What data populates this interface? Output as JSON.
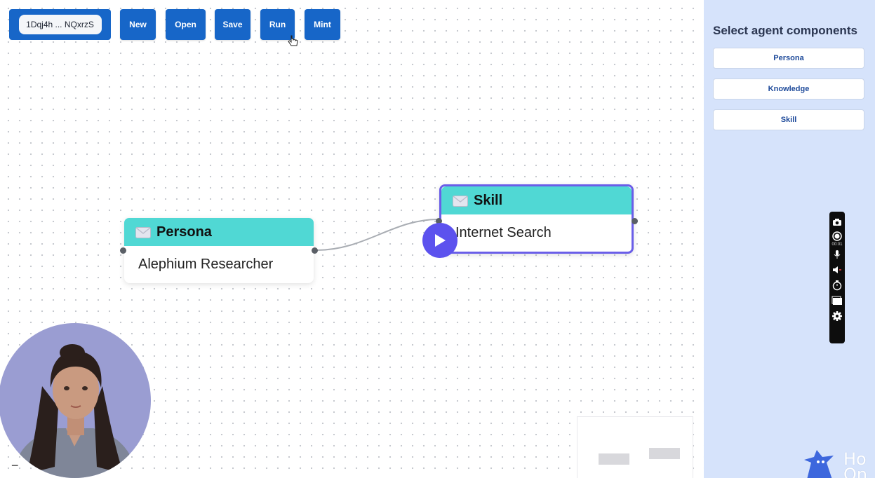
{
  "toolbar": {
    "wallet_address": "1Dqj4h ... NQxrzS",
    "buttons": [
      "New",
      "Open",
      "Save",
      "Run",
      "Mint"
    ]
  },
  "nodes": {
    "persona": {
      "header": "Persona",
      "value": "Alephium Researcher"
    },
    "skill": {
      "header": "Skill",
      "value": "Internet Search"
    }
  },
  "panel": {
    "title": "Select agent components",
    "components": [
      "Persona",
      "Knowledge",
      "Skill"
    ]
  },
  "recorder": {
    "time": "00:01"
  },
  "brand": {
    "line1": "Ho",
    "line2": "On"
  },
  "colors": {
    "toolbar_blue": "#1766c8",
    "node_header": "#50d8d4",
    "selected_border": "#6a5ee8",
    "panel_bg": "#d6e3fb",
    "play_button": "#5c52ee"
  },
  "icons": [
    "envelope-icon",
    "pointer-cursor-icon",
    "play-icon",
    "camera-icon",
    "record-icon",
    "microphone-icon",
    "speaker-icon",
    "timer-icon",
    "window-icon",
    "gear-icon"
  ]
}
